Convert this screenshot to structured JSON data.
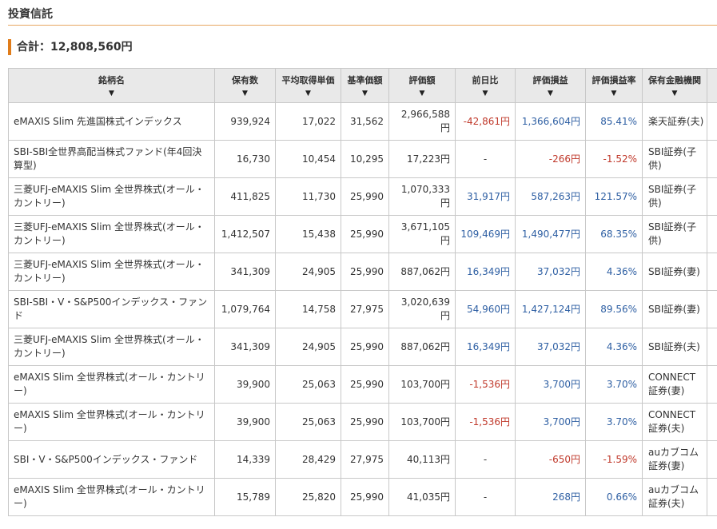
{
  "section_title": "投資信託",
  "total_text": "合計：12,808,560円",
  "colors": {
    "accent": "#e07c1a",
    "negative": "#c0392b",
    "positive": "#2e5fa3",
    "header_bg": "#e9e9e9"
  },
  "sort_icon": "▼",
  "headers": [
    "銘柄名",
    "保有数",
    "平均取得単価",
    "基準価額",
    "評価額",
    "前日比",
    "評価損益",
    "評価損益率",
    "保有金融機関"
  ],
  "rows": [
    {
      "name": "eMAXIS Slim 先進国株式インデックス",
      "qty": "939,924",
      "avg": "17,022",
      "nav": "31,562",
      "value": "2,966,588円",
      "daychg": "-42,861円",
      "daychg_sign": "neg",
      "pl": "1,366,604円",
      "pl_sign": "pos",
      "plrate": "85.41%",
      "plrate_sign": "pos",
      "inst": "楽天証券(夫)"
    },
    {
      "name": "SBI-SBI全世界高配当株式ファンド(年4回決算型)",
      "qty": "16,730",
      "avg": "10,454",
      "nav": "10,295",
      "value": "17,223円",
      "daychg": "-",
      "daychg_sign": "none",
      "pl": "-266円",
      "pl_sign": "neg",
      "plrate": "-1.52%",
      "plrate_sign": "neg",
      "inst": "SBI証券(子供)"
    },
    {
      "name": "三菱UFJ-eMAXIS Slim 全世界株式(オール・カントリー)",
      "qty": "411,825",
      "avg": "11,730",
      "nav": "25,990",
      "value": "1,070,333円",
      "daychg": "31,917円",
      "daychg_sign": "pos",
      "pl": "587,263円",
      "pl_sign": "pos",
      "plrate": "121.57%",
      "plrate_sign": "pos",
      "inst": "SBI証券(子供)"
    },
    {
      "name": "三菱UFJ-eMAXIS Slim 全世界株式(オール・カントリー)",
      "qty": "1,412,507",
      "avg": "15,438",
      "nav": "25,990",
      "value": "3,671,105円",
      "daychg": "109,469円",
      "daychg_sign": "pos",
      "pl": "1,490,477円",
      "pl_sign": "pos",
      "plrate": "68.35%",
      "plrate_sign": "pos",
      "inst": "SBI証券(子供)"
    },
    {
      "name": "三菱UFJ-eMAXIS Slim 全世界株式(オール・カントリー)",
      "qty": "341,309",
      "avg": "24,905",
      "nav": "25,990",
      "value": "887,062円",
      "daychg": "16,349円",
      "daychg_sign": "pos",
      "pl": "37,032円",
      "pl_sign": "pos",
      "plrate": "4.36%",
      "plrate_sign": "pos",
      "inst": "SBI証券(妻)"
    },
    {
      "name": "SBI-SBI・V・S&P500インデックス・ファンド",
      "qty": "1,079,764",
      "avg": "14,758",
      "nav": "27,975",
      "value": "3,020,639円",
      "daychg": "54,960円",
      "daychg_sign": "pos",
      "pl": "1,427,124円",
      "pl_sign": "pos",
      "plrate": "89.56%",
      "plrate_sign": "pos",
      "inst": "SBI証券(妻)"
    },
    {
      "name": "三菱UFJ-eMAXIS Slim 全世界株式(オール・カントリー)",
      "qty": "341,309",
      "avg": "24,905",
      "nav": "25,990",
      "value": "887,062円",
      "daychg": "16,349円",
      "daychg_sign": "pos",
      "pl": "37,032円",
      "pl_sign": "pos",
      "plrate": "4.36%",
      "plrate_sign": "pos",
      "inst": "SBI証券(夫)"
    },
    {
      "name": "eMAXIS Slim 全世界株式(オール・カントリー)",
      "qty": "39,900",
      "avg": "25,063",
      "nav": "25,990",
      "value": "103,700円",
      "daychg": "-1,536円",
      "daychg_sign": "neg",
      "pl": "3,700円",
      "pl_sign": "pos",
      "plrate": "3.70%",
      "plrate_sign": "pos",
      "inst": "CONNECT証券(妻)"
    },
    {
      "name": "eMAXIS Slim 全世界株式(オール・カントリー)",
      "qty": "39,900",
      "avg": "25,063",
      "nav": "25,990",
      "value": "103,700円",
      "daychg": "-1,536円",
      "daychg_sign": "neg",
      "pl": "3,700円",
      "pl_sign": "pos",
      "plrate": "3.70%",
      "plrate_sign": "pos",
      "inst": "CONNECT証券(夫)"
    },
    {
      "name": "SBI・V・S&P500インデックス・ファンド",
      "qty": "14,339",
      "avg": "28,429",
      "nav": "27,975",
      "value": "40,113円",
      "daychg": "-",
      "daychg_sign": "none",
      "pl": "-650円",
      "pl_sign": "neg",
      "plrate": "-1.59%",
      "plrate_sign": "neg",
      "inst": "auカブコム証券(妻)"
    },
    {
      "name": "eMAXIS Slim 全世界株式(オール・カントリー)",
      "qty": "15,789",
      "avg": "25,820",
      "nav": "25,990",
      "value": "41,035円",
      "daychg": "-",
      "daychg_sign": "none",
      "pl": "268円",
      "pl_sign": "pos",
      "plrate": "0.66%",
      "plrate_sign": "pos",
      "inst": "auカブコム証券(夫)"
    }
  ]
}
